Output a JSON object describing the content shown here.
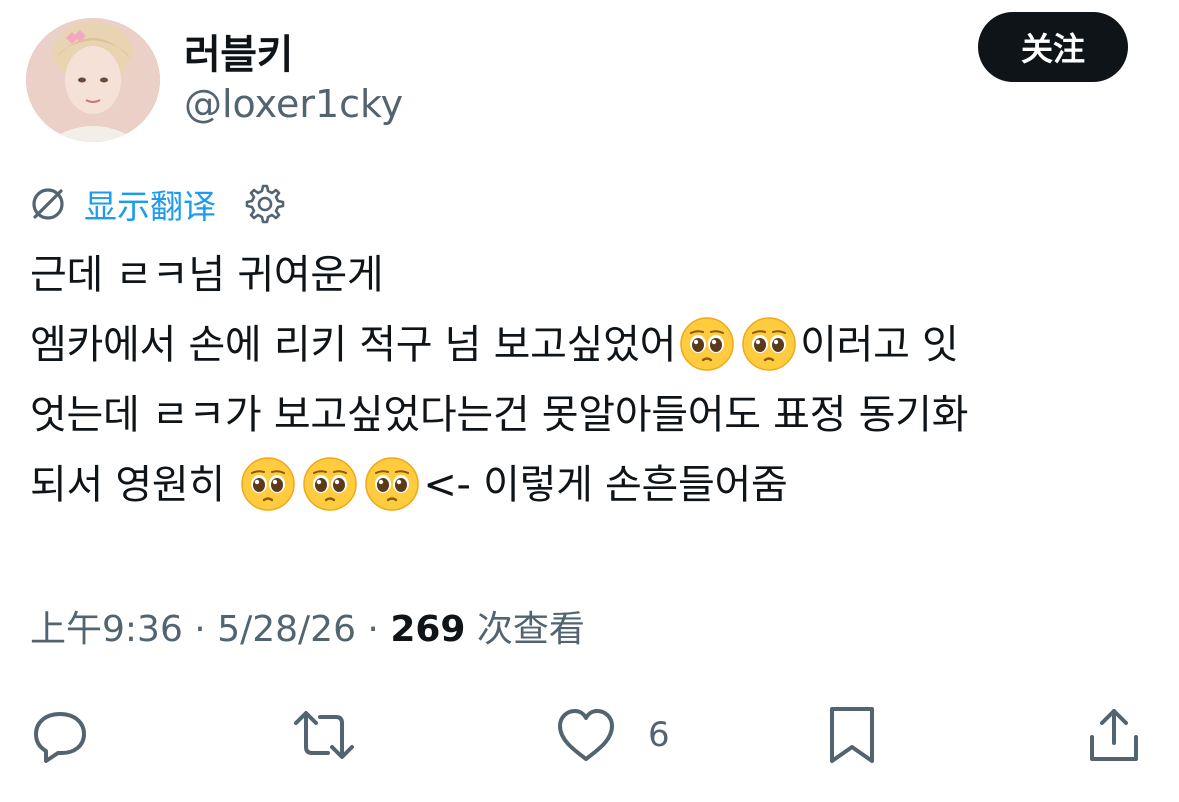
{
  "header": {
    "display_name": "러블키",
    "handle": "@loxer1cky",
    "follow_label": "关注"
  },
  "translate": {
    "label": "显示翻译"
  },
  "tweet": {
    "lines": {
      "l1": "근데 ㄹㅋ넘 귀여운게",
      "l2a": "엠카에서 손에 리키 적구 넘 보고싶었어",
      "l2b": "이러고 잇",
      "l3": "엇는데 ㄹㅋ가 보고싶었다는건 못알아들어도 표정 동기화",
      "l4a": "되서 영원히",
      "l4b": "<- 이렇게 손흔들어줌"
    },
    "emoji": "pleading-face"
  },
  "meta": {
    "time": "上午9:36",
    "dot1": " · ",
    "date": "5/28/26",
    "dot2": " · ",
    "views": "269",
    "views_label": " 次查看"
  },
  "actions": {
    "like_count": "6",
    "icons": [
      "reply-icon",
      "retweet-icon",
      "like-icon",
      "bookmark-icon",
      "share-icon"
    ]
  },
  "colors": {
    "text": "#0f1419",
    "secondary": "#536471",
    "link": "#1d9bf0",
    "button_bg": "#0f1419"
  }
}
